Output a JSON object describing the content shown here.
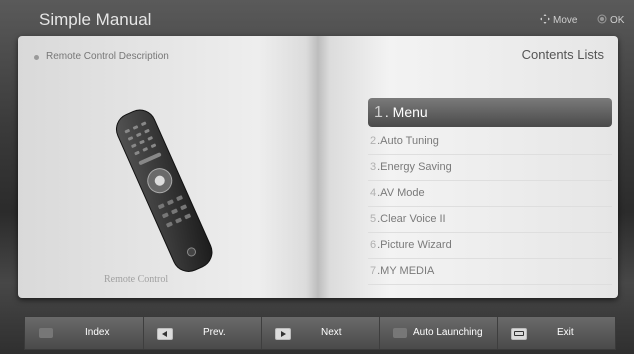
{
  "app": {
    "title": "Simple Manual"
  },
  "hints": {
    "move": "Move",
    "ok": "OK"
  },
  "left_page": {
    "section_title": "Remote Control Description",
    "caption": "Remote Control"
  },
  "right_page": {
    "title": "Contents Lists",
    "items": [
      {
        "num": "1",
        "label": ". Menu",
        "selected": true
      },
      {
        "num": "2",
        "label": ".Auto Tuning"
      },
      {
        "num": "3",
        "label": ".Energy Saving"
      },
      {
        "num": "4",
        "label": ".AV Mode"
      },
      {
        "num": "5",
        "label": ".Clear Voice II"
      },
      {
        "num": "6",
        "label": ".Picture Wizard"
      },
      {
        "num": "7",
        "label": ".MY MEDIA"
      }
    ]
  },
  "bottom_bar": {
    "buttons": [
      {
        "label": "Index"
      },
      {
        "label": "Prev."
      },
      {
        "label": "Next"
      },
      {
        "label": "Auto Launching"
      },
      {
        "label": "Exit"
      }
    ]
  }
}
